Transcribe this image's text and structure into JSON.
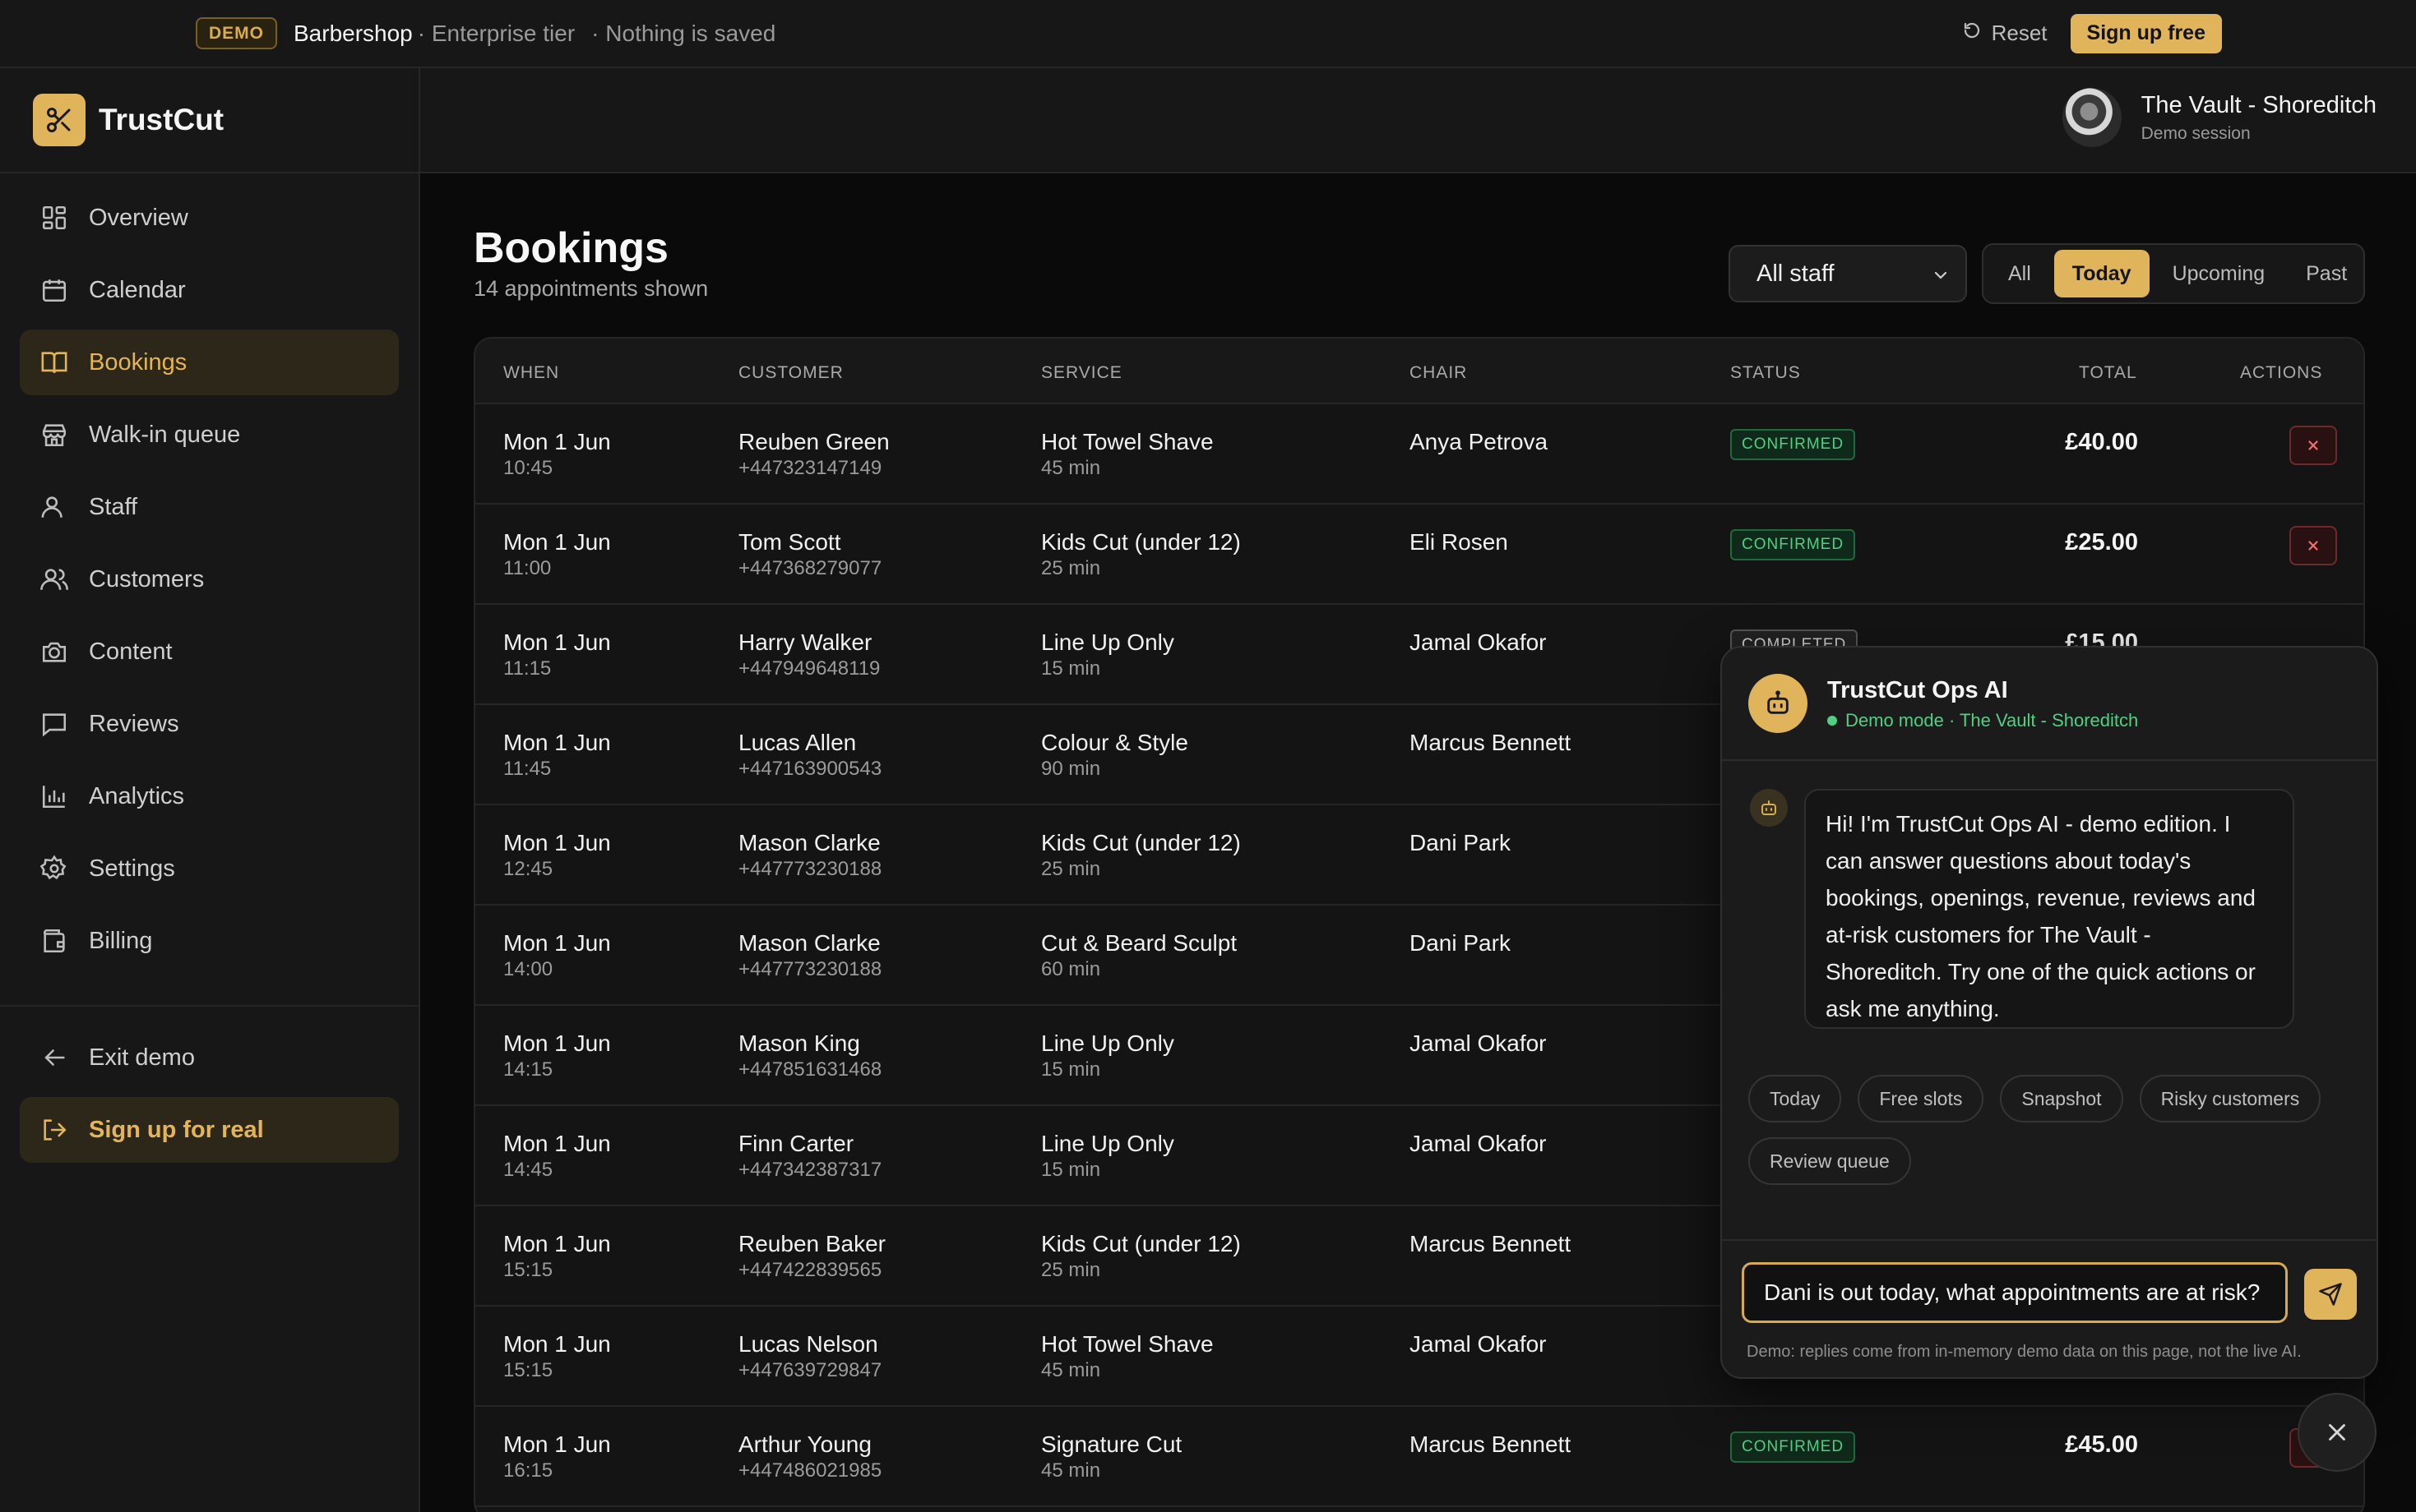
{
  "demobar": {
    "badge": "DEMO",
    "app": "Barbershop",
    "tier": "· Enterprise tier",
    "saved": "· Nothing is saved",
    "reset": "Reset",
    "signup": "Sign up free"
  },
  "brand": {
    "name": "TrustCut"
  },
  "shop": {
    "name": "The Vault - Shoreditch",
    "sub": "Demo session"
  },
  "nav": {
    "items": [
      {
        "label": "Overview",
        "icon": "grid-icon"
      },
      {
        "label": "Calendar",
        "icon": "calendar-icon"
      },
      {
        "label": "Bookings",
        "icon": "book-icon",
        "active": true
      },
      {
        "label": "Walk-in queue",
        "icon": "store-icon"
      },
      {
        "label": "Staff",
        "icon": "user-icon"
      },
      {
        "label": "Customers",
        "icon": "users-icon"
      },
      {
        "label": "Content",
        "icon": "camera-icon"
      },
      {
        "label": "Reviews",
        "icon": "message-icon"
      },
      {
        "label": "Analytics",
        "icon": "chart-icon"
      },
      {
        "label": "Settings",
        "icon": "gear-icon"
      },
      {
        "label": "Billing",
        "icon": "wallet-icon"
      }
    ],
    "exit": "Exit demo",
    "signup": "Sign up for real"
  },
  "page": {
    "title": "Bookings",
    "subtitle": "14 appointments shown",
    "staff_filter": "All staff",
    "segments": [
      "All",
      "Today",
      "Upcoming",
      "Past"
    ],
    "active_segment": "Today"
  },
  "table": {
    "headers": [
      "WHEN",
      "CUSTOMER",
      "SERVICE",
      "CHAIR",
      "STATUS",
      "TOTAL",
      "ACTIONS"
    ],
    "rows": [
      {
        "date": "Mon 1 Jun",
        "time": "10:45",
        "customer": "Reuben Green",
        "phone": "+447323147149",
        "service": "Hot Towel Shave",
        "duration": "45 min",
        "chair": "Anya Petrova",
        "status": "CONFIRMED",
        "total": "£40.00"
      },
      {
        "date": "Mon 1 Jun",
        "time": "11:00",
        "customer": "Tom Scott",
        "phone": "+447368279077",
        "service": "Kids Cut (under 12)",
        "duration": "25 min",
        "chair": "Eli Rosen",
        "status": "CONFIRMED",
        "total": "£25.00"
      },
      {
        "date": "Mon 1 Jun",
        "time": "11:15",
        "customer": "Harry Walker",
        "phone": "+447949648119",
        "service": "Line Up Only",
        "duration": "15 min",
        "chair": "Jamal Okafor",
        "status": "COMPLETED",
        "total": "£15.00"
      },
      {
        "date": "Mon 1 Jun",
        "time": "11:45",
        "customer": "Lucas Allen",
        "phone": "+447163900543",
        "service": "Colour & Style",
        "duration": "90 min",
        "chair": "Marcus Bennett"
      },
      {
        "date": "Mon 1 Jun",
        "time": "12:45",
        "customer": "Mason Clarke",
        "phone": "+447773230188",
        "service": "Kids Cut (under 12)",
        "duration": "25 min",
        "chair": "Dani Park"
      },
      {
        "date": "Mon 1 Jun",
        "time": "14:00",
        "customer": "Mason Clarke",
        "phone": "+447773230188",
        "service": "Cut & Beard Sculpt",
        "duration": "60 min",
        "chair": "Dani Park"
      },
      {
        "date": "Mon 1 Jun",
        "time": "14:15",
        "customer": "Mason King",
        "phone": "+447851631468",
        "service": "Line Up Only",
        "duration": "15 min",
        "chair": "Jamal Okafor"
      },
      {
        "date": "Mon 1 Jun",
        "time": "14:45",
        "customer": "Finn Carter",
        "phone": "+447342387317",
        "service": "Line Up Only",
        "duration": "15 min",
        "chair": "Jamal Okafor"
      },
      {
        "date": "Mon 1 Jun",
        "time": "15:15",
        "customer": "Reuben Baker",
        "phone": "+447422839565",
        "service": "Kids Cut (under 12)",
        "duration": "25 min",
        "chair": "Marcus Bennett"
      },
      {
        "date": "Mon 1 Jun",
        "time": "15:15",
        "customer": "Lucas Nelson",
        "phone": "+447639729847",
        "service": "Hot Towel Shave",
        "duration": "45 min",
        "chair": "Jamal Okafor"
      },
      {
        "date": "Mon 1 Jun",
        "time": "16:15",
        "customer": "Arthur Young",
        "phone": "+447486021985",
        "service": "Signature Cut",
        "duration": "45 min",
        "chair": "Marcus Bennett",
        "status": "CONFIRMED",
        "total": "£45.00"
      }
    ]
  },
  "ai": {
    "title": "TrustCut Ops AI",
    "status": "Demo mode · The Vault - Shoreditch",
    "message": "Hi! I'm TrustCut Ops AI - demo edition. I can answer questions about today's bookings, openings, revenue, reviews and at-risk customers for The Vault - Shoreditch. Try one of the quick actions or ask me anything.",
    "chips": [
      "Today",
      "Free slots",
      "Snapshot",
      "Risky customers",
      "Review queue"
    ],
    "input_value": "Dani is out today, what appointments are at risk?",
    "note": "Demo: replies come from in-memory demo data on this page, not the live AI."
  },
  "colors": {
    "accent": "#e0b45a",
    "confirmed": "#4fd083",
    "danger": "#e05555",
    "background": "#0a0a0a"
  }
}
